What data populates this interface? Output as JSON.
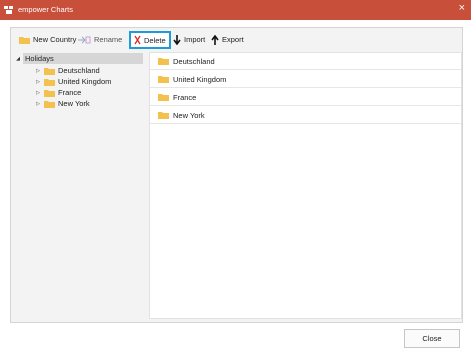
{
  "window": {
    "title": "empower Charts",
    "close_glyph": "×"
  },
  "toolbar": {
    "new_country": "New Country",
    "rename": "Rename",
    "delete": "Delete",
    "import": "Import",
    "export": "Export"
  },
  "tree": {
    "root": "Holidays",
    "children": [
      "Deutschland",
      "United Kingdom",
      "France",
      "New York"
    ]
  },
  "list": {
    "items": [
      "Deutschland",
      "United Kingdom",
      "France",
      "New York"
    ]
  },
  "footer": {
    "close_label": "Close"
  },
  "colors": {
    "titlebar": "#c8503a",
    "folder": "#f2c14e",
    "highlight_border": "#1f9bd6",
    "delete_icon": "#d62b2b"
  }
}
